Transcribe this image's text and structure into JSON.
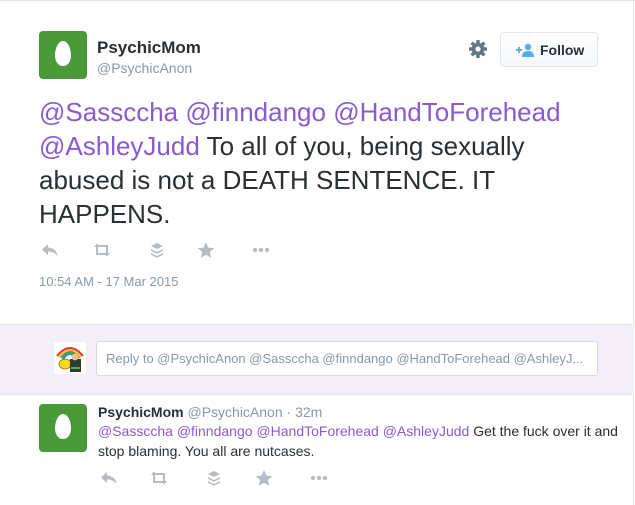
{
  "tweet": {
    "name": "PsychicMom",
    "handle": "@PsychicAnon",
    "mentions": [
      "@Sassccha",
      "@finndango",
      "@HandToForehead",
      "@AshleyJudd"
    ],
    "text": "To all of you, being sexually abused is not a DEATH SENTENCE.  IT HAPPENS.",
    "timestamp": "10:54 AM - 17 Mar 2015"
  },
  "follow": {
    "label": "Follow"
  },
  "reply_box": {
    "placeholder": "Reply to @PsychicAnon @Sassccha @finndango @HandToForehead @AshleyJ..."
  },
  "reply": {
    "name": "PsychicMom",
    "handle": "@PsychicAnon",
    "separator": "·",
    "time": "32m",
    "mentions": [
      "@Sassccha",
      "@finndango",
      "@HandToForehead",
      "@AshleyJudd"
    ],
    "text": "Get the fuck over it and stop blaming. You all are nutcases."
  },
  "icons": [
    "gear-icon",
    "follow-person-icon",
    "reply-icon",
    "retweet-icon",
    "stack-icon",
    "favorite-star-icon",
    "more-dots-icon"
  ],
  "colors": {
    "mention": "#8a5ad2",
    "avatar_bg": "#4a9a3a",
    "reply_bg": "#f3eff9",
    "muted": "#8899a6",
    "icon": "#b5bdc3"
  }
}
